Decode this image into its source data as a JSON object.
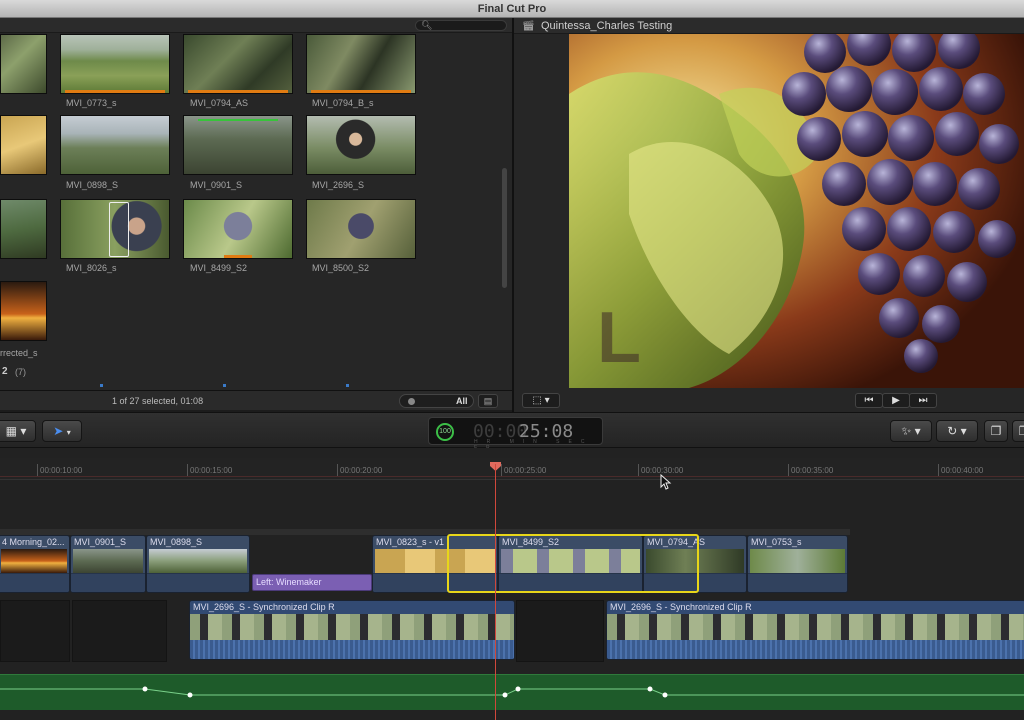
{
  "app": {
    "title": "Final Cut Pro"
  },
  "browser": {
    "search_icon": "search-icon",
    "clips": [
      {
        "name": "MVI_0773_s",
        "orange_bar": true
      },
      {
        "name": "MVI_0794_AS",
        "orange_bar": true
      },
      {
        "name": "MVI_0794_B_s",
        "orange_bar": true
      },
      {
        "name": "MVI_0898_S",
        "orange_bar": false
      },
      {
        "name": "MVI_0901_S",
        "orange_bar": false
      },
      {
        "name": "MVI_2696_S",
        "orange_bar": false
      },
      {
        "name": "MVI_8026_s",
        "orange_bar": false
      },
      {
        "name": "MVI_8499_S2",
        "orange_bar": true
      },
      {
        "name": "MVI_8500_S2",
        "orange_bar": false
      },
      {
        "name": "rrected_s",
        "orange_bar": false
      }
    ],
    "event_count_label": "2",
    "event_count_value": "(7)",
    "selection_status": "1 of 27 selected, 01:08",
    "zoom_label": "All"
  },
  "viewer": {
    "title": "Quintessa_Charles Testing",
    "overlay_letter": "L",
    "buttons": {
      "prev": "⏮",
      "play": "▶",
      "next": "⏭"
    }
  },
  "toolbar": {
    "timecode_percent": "100",
    "timecode_dim": "00:00",
    "timecode_value": "25:08",
    "timecode_units": "HR MIN SEC FR"
  },
  "timeline": {
    "ruler_ticks": [
      "00:00:10:00",
      "00:00:15:00",
      "00:00:20:00",
      "00:00:25:00",
      "00:00:30:00",
      "00:00:35:00",
      "00:00:40:00"
    ],
    "primary_clips": [
      {
        "name": "4 Morning_02..."
      },
      {
        "name": "MVI_0901_S"
      },
      {
        "name": "MVI_0898_S"
      },
      {
        "name": "MVI_0823_s - v1"
      },
      {
        "name": "MVI_8499_S2"
      },
      {
        "name": "MVI_0794_AS"
      },
      {
        "name": "MVI_0753_s"
      }
    ],
    "title_clip": "Left: Winemaker",
    "connected_clips": [
      {
        "name": "MVI_2696_S - Synchronized Clip R"
      },
      {
        "name": "MVI_2696_S - Synchronized Clip R"
      }
    ]
  }
}
